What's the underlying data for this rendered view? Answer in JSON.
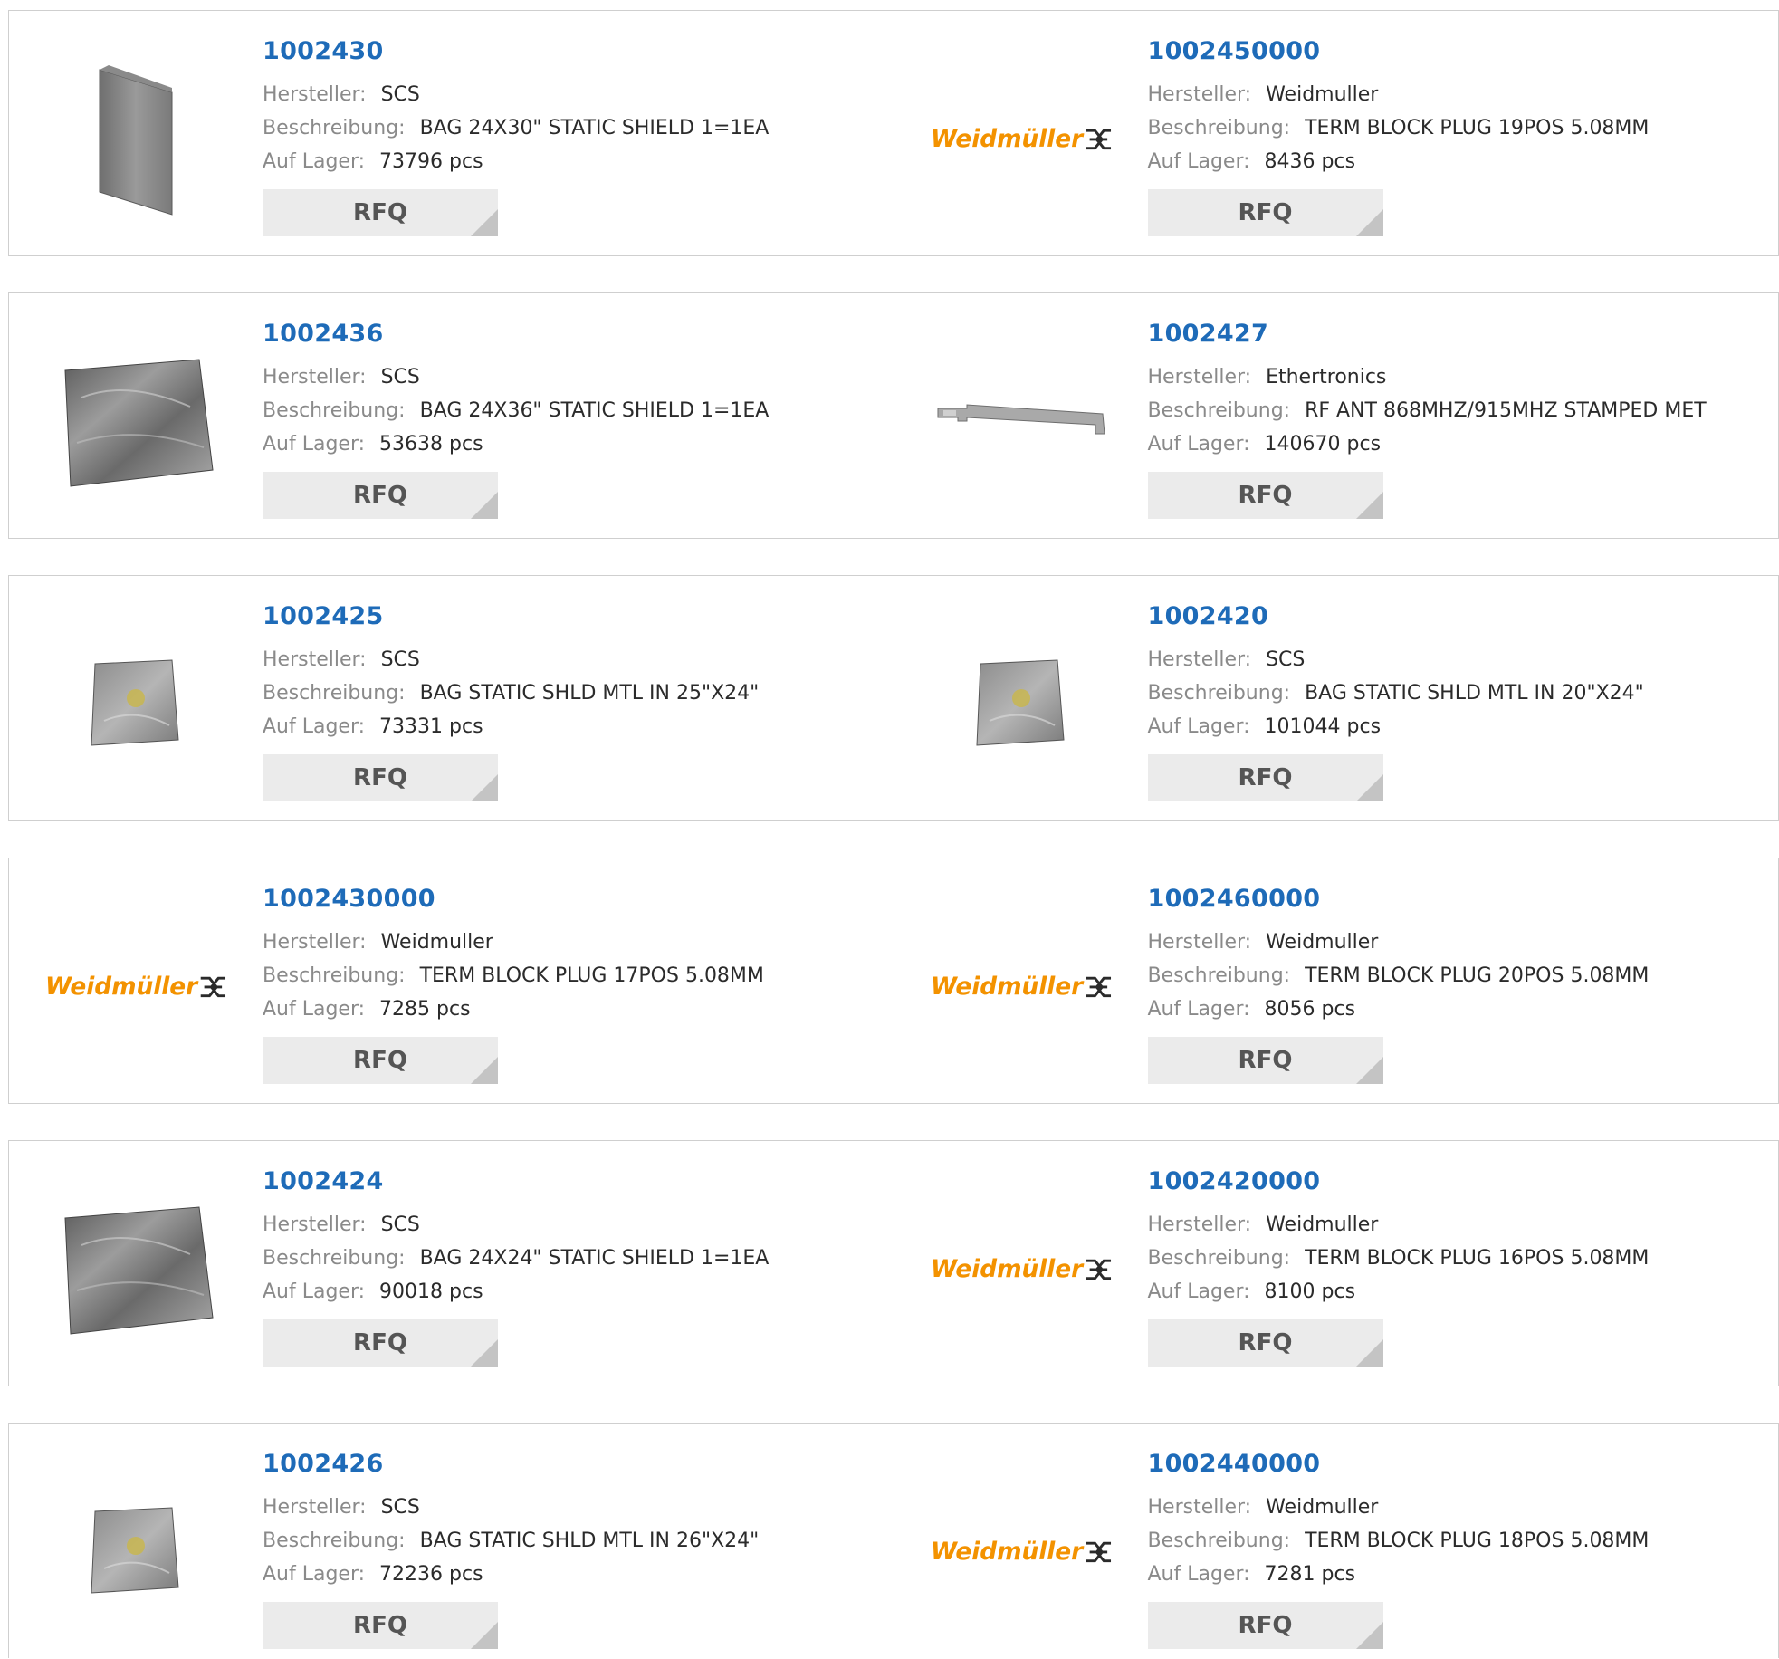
{
  "labels": {
    "manufacturer": "Hersteller:",
    "description": "Beschreibung:",
    "stock": "Auf Lager:",
    "rfq": "RFQ"
  },
  "logo_text": "Weidmüller",
  "products": [
    {
      "part": "1002430",
      "manufacturer": "SCS",
      "description": "BAG 24X30\" STATIC SHIELD 1=1EA",
      "stock": "73796 pcs",
      "image": "static-shield-bag-flat-image"
    },
    {
      "part": "1002450000",
      "manufacturer": "Weidmuller",
      "description": "TERM BLOCK PLUG 19POS 5.08MM",
      "stock": "8436 pcs",
      "image": "weidmuller-logo"
    },
    {
      "part": "1002436",
      "manufacturer": "SCS",
      "description": "BAG 24X36\" STATIC SHIELD 1=1EA",
      "stock": "53638 pcs",
      "image": "static-shield-bag-image"
    },
    {
      "part": "1002427",
      "manufacturer": "Ethertronics",
      "description": "RF ANT 868MHZ/915MHZ STAMPED MET",
      "stock": "140670 pcs",
      "image": "stamped-antenna-image"
    },
    {
      "part": "1002425",
      "manufacturer": "SCS",
      "description": "BAG STATIC SHLD MTL IN 25\"X24\"",
      "stock": "73331 pcs",
      "image": "static-bag-small-image"
    },
    {
      "part": "1002420",
      "manufacturer": "SCS",
      "description": "BAG STATIC SHLD MTL IN 20\"X24\"",
      "stock": "101044 pcs",
      "image": "static-bag-small-image"
    },
    {
      "part": "1002430000",
      "manufacturer": "Weidmuller",
      "description": "TERM BLOCK PLUG 17POS 5.08MM",
      "stock": "7285 pcs",
      "image": "weidmuller-logo"
    },
    {
      "part": "1002460000",
      "manufacturer": "Weidmuller",
      "description": "TERM BLOCK PLUG 20POS 5.08MM",
      "stock": "8056 pcs",
      "image": "weidmuller-logo"
    },
    {
      "part": "1002424",
      "manufacturer": "SCS",
      "description": "BAG 24X24\" STATIC SHIELD 1=1EA",
      "stock": "90018 pcs",
      "image": "static-shield-bag-image"
    },
    {
      "part": "1002420000",
      "manufacturer": "Weidmuller",
      "description": "TERM BLOCK PLUG 16POS 5.08MM",
      "stock": "8100 pcs",
      "image": "weidmuller-logo"
    },
    {
      "part": "1002426",
      "manufacturer": "SCS",
      "description": "BAG STATIC SHLD MTL IN 26\"X24\"",
      "stock": "72236 pcs",
      "image": "static-bag-small-image"
    },
    {
      "part": "1002440000",
      "manufacturer": "Weidmuller",
      "description": "TERM BLOCK PLUG 18POS 5.08MM",
      "stock": "7281 pcs",
      "image": "weidmuller-logo"
    }
  ]
}
